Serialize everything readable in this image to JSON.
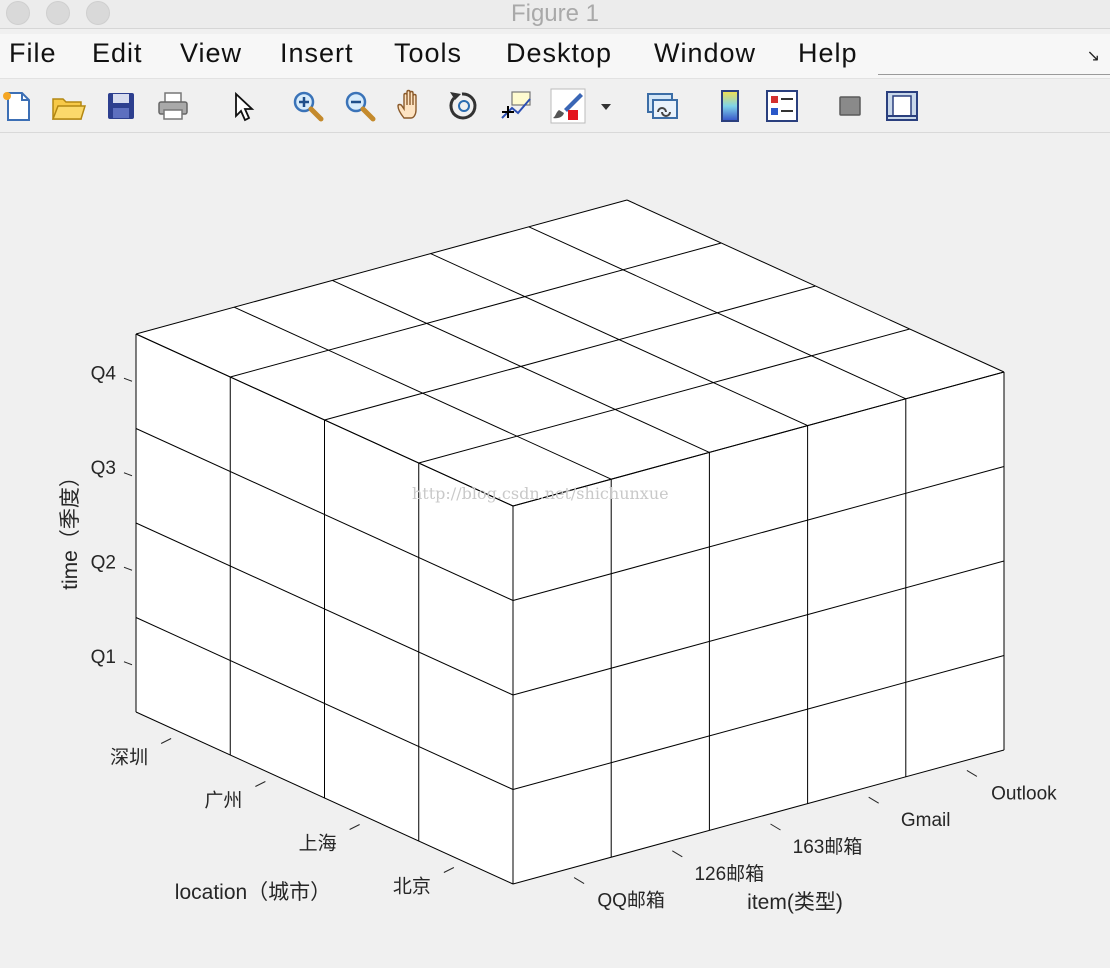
{
  "window": {
    "title": "Figure 1"
  },
  "menu": [
    "File",
    "Edit",
    "View",
    "Insert",
    "Tools",
    "Desktop",
    "Window",
    "Help"
  ],
  "toolbar": [
    {
      "name": "new-figure-icon"
    },
    {
      "name": "open-file-icon"
    },
    {
      "name": "save-icon"
    },
    {
      "name": "print-icon"
    },
    {
      "name": "pointer-arrow-icon"
    },
    {
      "name": "zoom-in-icon"
    },
    {
      "name": "zoom-out-icon"
    },
    {
      "name": "pan-hand-icon"
    },
    {
      "name": "rotate-3d-icon"
    },
    {
      "name": "data-cursor-icon"
    },
    {
      "name": "brush-icon"
    },
    {
      "name": "dropdown-arrow-icon"
    },
    {
      "name": "link-plot-icon"
    },
    {
      "name": "colorbar-icon"
    },
    {
      "name": "legend-icon"
    },
    {
      "name": "hide-plot-tools-icon"
    },
    {
      "name": "show-plot-tools-icon"
    }
  ],
  "chart_data": {
    "type": "3d-cube-grid",
    "x_axis": {
      "label": "item(类型)",
      "ticks": [
        "QQ邮箱",
        "126邮箱",
        "163邮箱",
        "Gmail",
        "Outlook"
      ]
    },
    "y_axis": {
      "label": "location（城市）",
      "ticks": [
        "北京",
        "上海",
        "广州",
        "深圳"
      ]
    },
    "z_axis": {
      "label": "time（季度）",
      "ticks": [
        "Q1",
        "Q2",
        "Q3",
        "Q4"
      ]
    },
    "cells": {
      "x": 5,
      "y": 4,
      "z": 4
    },
    "grid": false,
    "face_color": "#ffffff",
    "edge_color": "#000000"
  },
  "watermark": "http://blog.csdn.net/shichunxue"
}
